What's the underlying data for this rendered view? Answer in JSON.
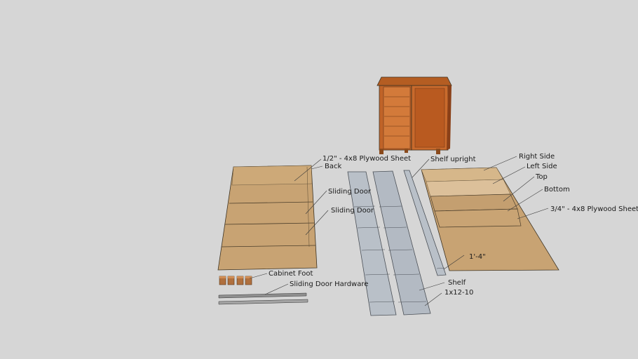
{
  "labels": {
    "plywood_half": "1/2\" - 4x8 Plywood Sheet",
    "back": "Back",
    "sliding_door_1": "Sliding Door",
    "sliding_door_2": "Sliding Door",
    "shelf_upright": "Shelf upright",
    "right_side": "Right Side",
    "left_side": "Left Side",
    "top": "Top",
    "bottom": "Bottom",
    "plywood_three_quarter": "3/4\" - 4x8 Plywood Sheet",
    "cabinet_foot": "Cabinet Foot",
    "sliding_door_hardware": "Sliding Door Hardware",
    "shelf": "Shelf",
    "board_1x12": "1x12-10",
    "dimension": "1'-4\""
  },
  "colors": {
    "background": "#d6d6d6",
    "plywood": "#c8a373",
    "plywood_light": "#d8b98e",
    "board": "#b9c0c8",
    "wood_dark": "#a14f1e",
    "wood_mid": "#c86a2a"
  }
}
